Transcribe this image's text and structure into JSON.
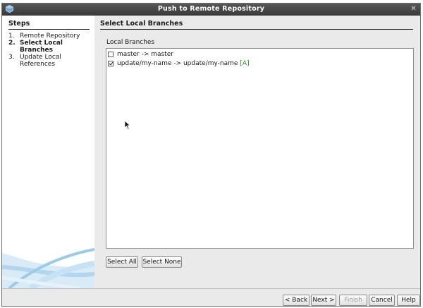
{
  "window": {
    "title": "Push to Remote Repository",
    "close_glyph": "✕"
  },
  "steps": {
    "title": "Steps",
    "items": [
      {
        "num": "1.",
        "label": "Remote Repository"
      },
      {
        "num": "2.",
        "label": "Select Local Branches",
        "current": true
      },
      {
        "num": "3.",
        "label": "Update Local References"
      }
    ]
  },
  "panel": {
    "title": "Select Local Branches",
    "group_label": "Local Branches",
    "branches": [
      {
        "text": "master -> master",
        "checked": false,
        "status": ""
      },
      {
        "text": "update/my-name -> update/my-name",
        "checked": true,
        "status": "[A]"
      }
    ],
    "select_all": "Select All",
    "select_none": "Select None"
  },
  "buttons": {
    "back": "< Back",
    "next": "Next >",
    "finish": "Finish",
    "cancel": "Cancel",
    "help": "Help"
  },
  "colors": {
    "titlebar": "#474747",
    "window_bg": "#eaeaea",
    "added_status": "#1f8a1f"
  },
  "icons": {
    "app": "netbeans-app-icon",
    "cursor": "mouse-pointer-icon"
  }
}
